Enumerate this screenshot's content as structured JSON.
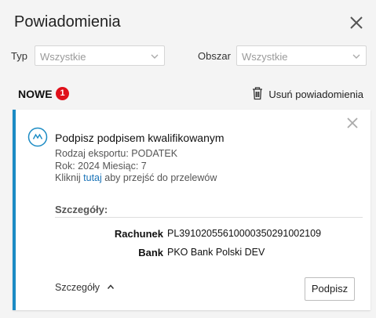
{
  "header": {
    "title": "Powiadomienia"
  },
  "filters": {
    "type_label": "Typ",
    "type_value": "Wszystkie",
    "area_label": "Obszar",
    "area_value": "Wszystkie"
  },
  "section": {
    "title": "NOWE",
    "count": "1",
    "remove_label": "Usuń powiadomienia"
  },
  "notification": {
    "title": "Podpisz podpisem kwalifikowanym",
    "line1": "Rodzaj eksportu: PODATEK",
    "line2": "Rok: 2024 Miesiąc: 7",
    "line3_prefix": "Kliknij",
    "line3_link": "tutaj",
    "line3_suffix": "aby przejść do przelewów",
    "details_heading": "Szczegóły:",
    "details": [
      {
        "label": "Rachunek",
        "value": "PL39102055610000350291002109"
      },
      {
        "label": "Bank",
        "value": "PKO Bank Polski DEV"
      }
    ],
    "toggle_label": "Szczegóły",
    "sign_button": "Podpisz"
  },
  "colors": {
    "accent": "#1b8bc4",
    "badge": "#e0101a",
    "link": "#1a73b8"
  }
}
